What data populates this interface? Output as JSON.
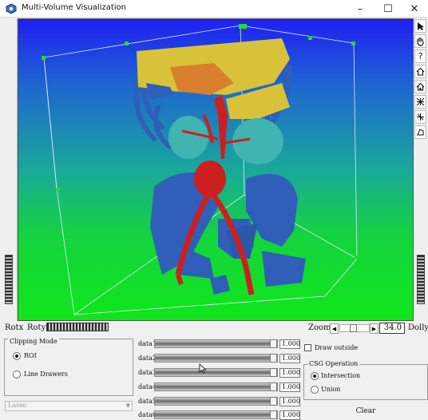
{
  "window": {
    "title": "Multi-Volume Visualization",
    "minimize": "–",
    "maximize": "☐",
    "close": "✕"
  },
  "toolbar_right": {
    "tools": [
      "pointer-icon",
      "hand-icon",
      "help-icon",
      "home-icon",
      "home-alt-icon",
      "grid-icon",
      "axis-icon",
      "perspective-icon"
    ],
    "help_glyph": "?"
  },
  "rotation": {
    "rotx_label": "Rotx",
    "roty_label": "Roty"
  },
  "zoom": {
    "label": "Zoom",
    "value": "34.0",
    "dolly_label": "Dolly"
  },
  "clipping": {
    "group_label": "Clipping Mode",
    "options": [
      "ROI",
      "Line Drawers"
    ],
    "selected": "ROI",
    "lasso_placeholder": "Lasso"
  },
  "data_sliders": [
    {
      "label": "data1",
      "value": "1.000"
    },
    {
      "label": "data2",
      "value": "1.000"
    },
    {
      "label": "data3",
      "value": "1.000"
    },
    {
      "label": "data4",
      "value": "1.000"
    },
    {
      "label": "data5",
      "value": "1.000"
    },
    {
      "label": "data6",
      "value": "1.000"
    }
  ],
  "draw_outside": {
    "label": "Draw outside",
    "checked": false
  },
  "csg": {
    "group_label": "CSG Operation",
    "options": [
      "Intersection",
      "Union"
    ],
    "selected": "Intersection"
  },
  "clear_label": "Clear",
  "colors": {
    "bone": "#2f5fb8",
    "aorta": "#cc2020",
    "liver": "#d8c23a",
    "kidney": "#3fb4b0",
    "background_top": "#1f1ff2",
    "background_bottom": "#10e61a"
  }
}
